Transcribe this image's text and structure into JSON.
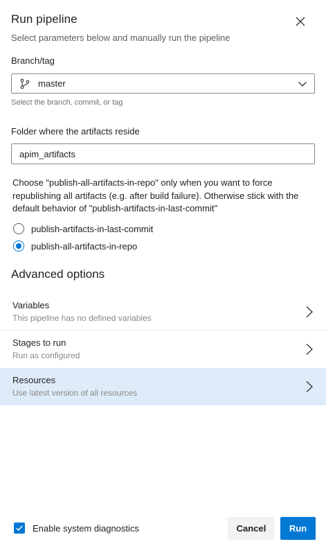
{
  "header": {
    "title": "Run pipeline",
    "subtitle": "Select parameters below and manually run the pipeline"
  },
  "branch": {
    "label": "Branch/tag",
    "value": "master",
    "helper": "Select the branch, commit, or tag"
  },
  "folder": {
    "label": "Folder where the artifacts reside",
    "value": "apim_artifacts"
  },
  "publish": {
    "description": "Choose \"publish-all-artifacts-in-repo\" only when you want to force republishing all artifacts (e.g. after build failure). Otherwise stick with the default behavior of \"publish-artifacts-in-last-commit\"",
    "options": [
      {
        "label": "publish-artifacts-in-last-commit",
        "checked": false
      },
      {
        "label": "publish-all-artifacts-in-repo",
        "checked": true
      }
    ]
  },
  "advanced": {
    "title": "Advanced options",
    "rows": [
      {
        "title": "Variables",
        "subtitle": "This pipeline has no defined variables"
      },
      {
        "title": "Stages to run",
        "subtitle": "Run as configured"
      },
      {
        "title": "Resources",
        "subtitle": "Use latest version of all resources"
      }
    ]
  },
  "footer": {
    "diagnostics_label": "Enable system diagnostics",
    "diagnostics_checked": true,
    "cancel_label": "Cancel",
    "run_label": "Run"
  },
  "colors": {
    "accent": "#0078d4",
    "selected_row": "#deecf9",
    "secondary_button": "#f3f2f1"
  },
  "icons": {
    "close": "close-icon",
    "branch": "branch-icon",
    "dropdown": "chevron-down-icon",
    "row_arrow": "chevron-right-icon",
    "check": "checkmark-icon"
  }
}
